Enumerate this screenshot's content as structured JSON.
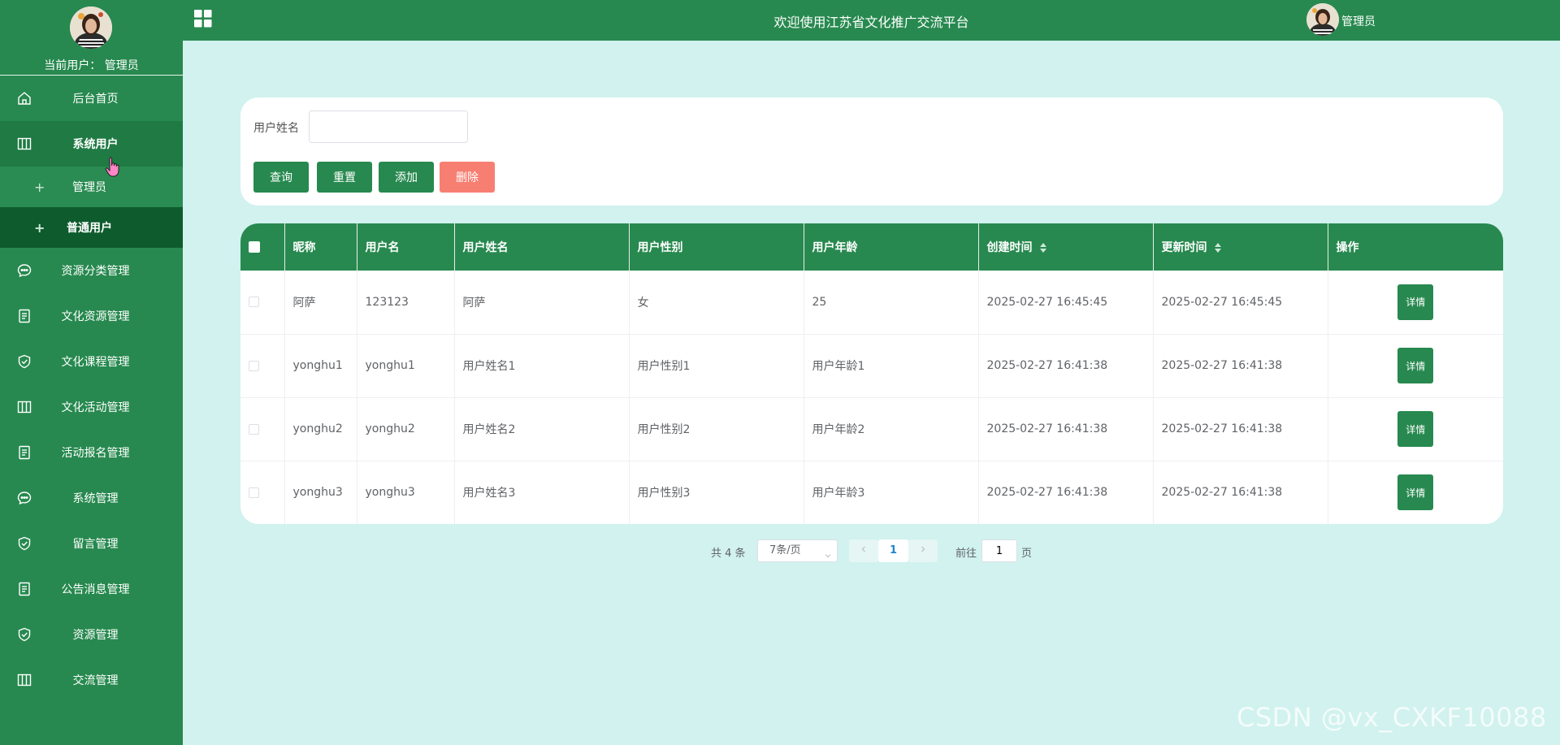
{
  "header": {
    "title": "欢迎使用江苏省文化推广交流平台",
    "username": "管理员"
  },
  "sidebar": {
    "current_user": "当前用户： 管理员",
    "items": [
      {
        "label": "后台首页",
        "icon": "home-icon"
      },
      {
        "label": "系统用户",
        "icon": "columns-icon"
      },
      {
        "label": "资源分类管理",
        "icon": "chat-icon"
      },
      {
        "label": "文化资源管理",
        "icon": "document-icon"
      },
      {
        "label": "文化课程管理",
        "icon": "shield-check-icon"
      },
      {
        "label": "文化活动管理",
        "icon": "columns-icon"
      },
      {
        "label": "活动报名管理",
        "icon": "document-icon"
      },
      {
        "label": "系统管理",
        "icon": "chat-icon"
      },
      {
        "label": "留言管理",
        "icon": "shield-check-icon"
      },
      {
        "label": "公告消息管理",
        "icon": "document-icon"
      },
      {
        "label": "资源管理",
        "icon": "shield-check-icon"
      },
      {
        "label": "交流管理",
        "icon": "columns-icon"
      }
    ],
    "sub_items": [
      {
        "label": "管理员"
      },
      {
        "label": "普通用户"
      }
    ]
  },
  "search": {
    "label": "用户姓名",
    "value": "",
    "buttons": {
      "query": "查询",
      "reset": "重置",
      "add": "添加",
      "delete": "删除"
    }
  },
  "table": {
    "columns": [
      "昵称",
      "用户名",
      "用户姓名",
      "用户性别",
      "用户年龄",
      "创建时间",
      "更新时间",
      "操作"
    ],
    "detail_label": "详情",
    "rows": [
      {
        "nickname": "阿萨",
        "username": "123123",
        "name": "阿萨",
        "gender": "女",
        "age": "25",
        "created": "2025-02-27 16:45:45",
        "updated": "2025-02-27 16:45:45"
      },
      {
        "nickname": "yonghu1",
        "username": "yonghu1",
        "name": "用户姓名1",
        "gender": "用户性别1",
        "age": "用户年龄1",
        "created": "2025-02-27 16:41:38",
        "updated": "2025-02-27 16:41:38"
      },
      {
        "nickname": "yonghu2",
        "username": "yonghu2",
        "name": "用户姓名2",
        "gender": "用户性别2",
        "age": "用户年龄2",
        "created": "2025-02-27 16:41:38",
        "updated": "2025-02-27 16:41:38"
      },
      {
        "nickname": "yonghu3",
        "username": "yonghu3",
        "name": "用户姓名3",
        "gender": "用户性别3",
        "age": "用户年龄3",
        "created": "2025-02-27 16:41:38",
        "updated": "2025-02-27 16:41:38"
      }
    ]
  },
  "pagination": {
    "total": "共 4 条",
    "page_size": "7条/页",
    "current_page": "1",
    "goto_prefix": "前往",
    "goto_value": "1",
    "goto_suffix": "页"
  },
  "watermark": "CSDN @vx_CXKF10088",
  "colors": {
    "primary": "#27894f",
    "background": "#d1f2ef",
    "danger": "#f77f72",
    "active_sub": "#0e5c2e"
  }
}
